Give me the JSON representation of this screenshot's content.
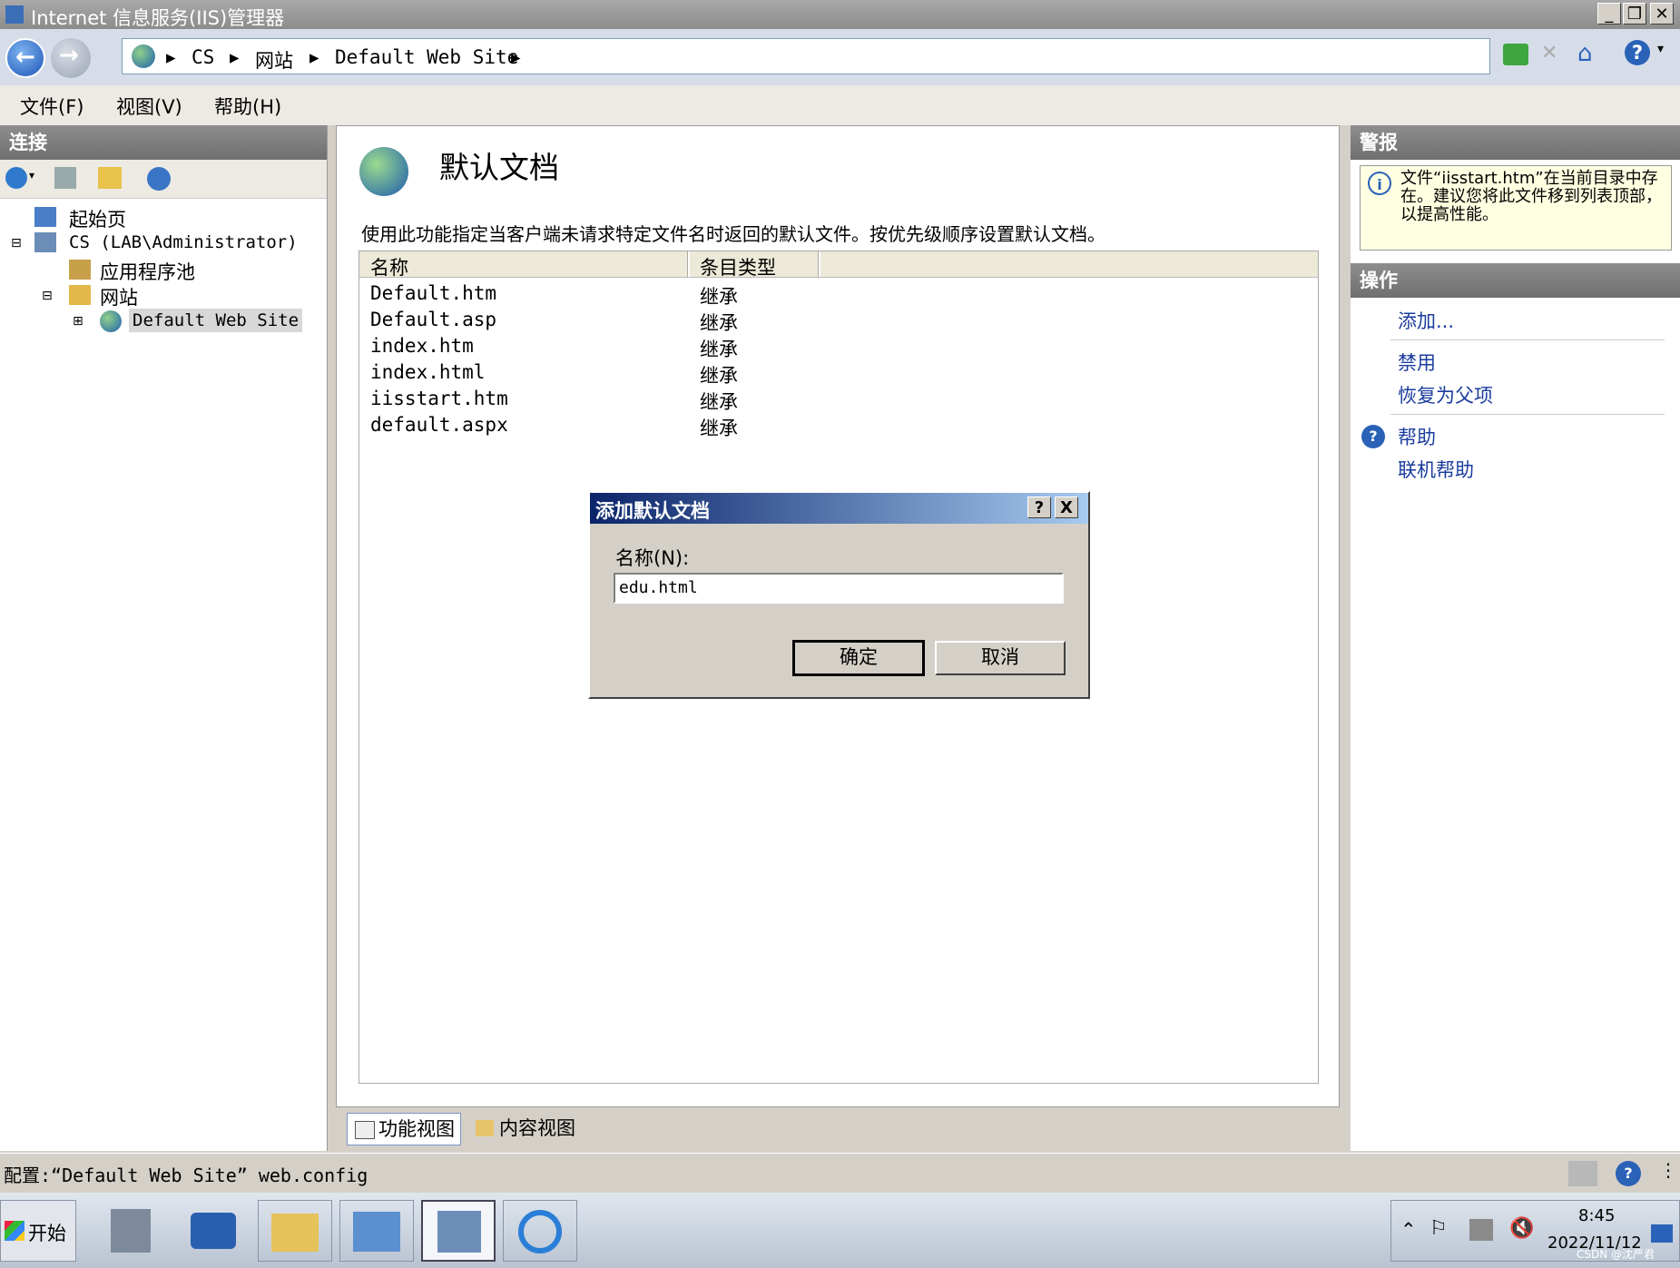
{
  "window": {
    "title": "Internet 信息服务(IIS)管理器"
  },
  "address": {
    "segments": [
      "CS",
      "网站",
      "Default Web Site"
    ]
  },
  "menu": {
    "file": "文件(F)",
    "view": "视图(V)",
    "help": "帮助(H)"
  },
  "connections": {
    "title": "连接",
    "tree": {
      "start": "起始页",
      "server": "CS (LAB\\Administrator)",
      "apppools": "应用程序池",
      "sites": "网站",
      "site": "Default Web Site"
    }
  },
  "main": {
    "title": "默认文档",
    "description": "使用此功能指定当客户端未请求特定文件名时返回的默认文件。按优先级顺序设置默认文档。",
    "columns": {
      "name": "名称",
      "type": "条目类型"
    },
    "rows": [
      {
        "name": "Default.htm",
        "type": "继承"
      },
      {
        "name": "Default.asp",
        "type": "继承"
      },
      {
        "name": "index.htm",
        "type": "继承"
      },
      {
        "name": "index.html",
        "type": "继承"
      },
      {
        "name": "iisstart.htm",
        "type": "继承"
      },
      {
        "name": "default.aspx",
        "type": "继承"
      }
    ],
    "tabs": {
      "features": "功能视图",
      "content": "内容视图"
    }
  },
  "dialog": {
    "title": "添加默认文档",
    "help_btn": "?",
    "close_btn": "X",
    "name_label": "名称(N):",
    "name_value": "edu.html",
    "ok": "确定",
    "cancel": "取消"
  },
  "alerts": {
    "title": "警报",
    "message": "文件“iisstart.htm”在当前目录中存在。建议您将此文件移到列表顶部，以提高性能。"
  },
  "actions": {
    "title": "操作",
    "add": "添加...",
    "disable": "禁用",
    "revert": "恢复为父项",
    "help": "帮助",
    "online_help": "联机帮助"
  },
  "status": {
    "text": "配置:“Default Web Site” web.config"
  },
  "taskbar": {
    "start": "开始",
    "time": "8:45",
    "date": "2022/11/12",
    "watermark": "CSDN @沈严君"
  }
}
